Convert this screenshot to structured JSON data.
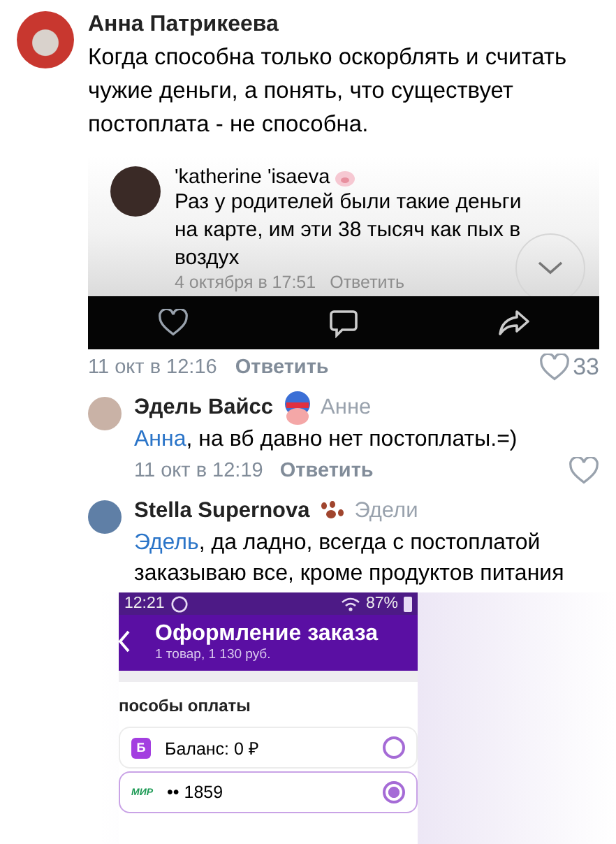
{
  "comment": {
    "author": "Анна Патрикеева",
    "text": "Когда способна только оскорблять и считать чужие деньги, а понять, что существует постоплата  - не способна.",
    "attachment": {
      "author": "'katherine 'isaeva",
      "text": "Раз у родителей были такие деньги на карте, им эти 38 тысяч как пых в воздух",
      "time": "4 октября в 17:51",
      "reply": "Ответить"
    },
    "time": "11 окт в 12:16",
    "reply": "Ответить",
    "likes": "33",
    "liked": false
  },
  "replies": [
    {
      "author": "Эдель Вайсс",
      "to": "Анне",
      "mention": "Анна",
      "text": ", на вб давно нет постоплаты.=)",
      "time": "11 окт в 12:19",
      "reply": "Ответить",
      "liked": false
    },
    {
      "author": "Stella Supernova",
      "to": "Эдели",
      "mention": "Эдель",
      "text": ", да ладно, всегда с постоплатой заказываю все, кроме продуктов питания",
      "attachment": {
        "status_time": "12:21",
        "battery": "87%",
        "title": "Оформление заказа",
        "subtitle": "1 товар, 1 130 руб.",
        "section": "пособы оплаты",
        "methods": [
          {
            "kind": "balance",
            "badge": "Б",
            "label": "Баланс: 0 ₽",
            "selected": false
          },
          {
            "kind": "card",
            "badge": "МИР",
            "label": "•• 1859",
            "selected": true
          }
        ]
      }
    }
  ]
}
